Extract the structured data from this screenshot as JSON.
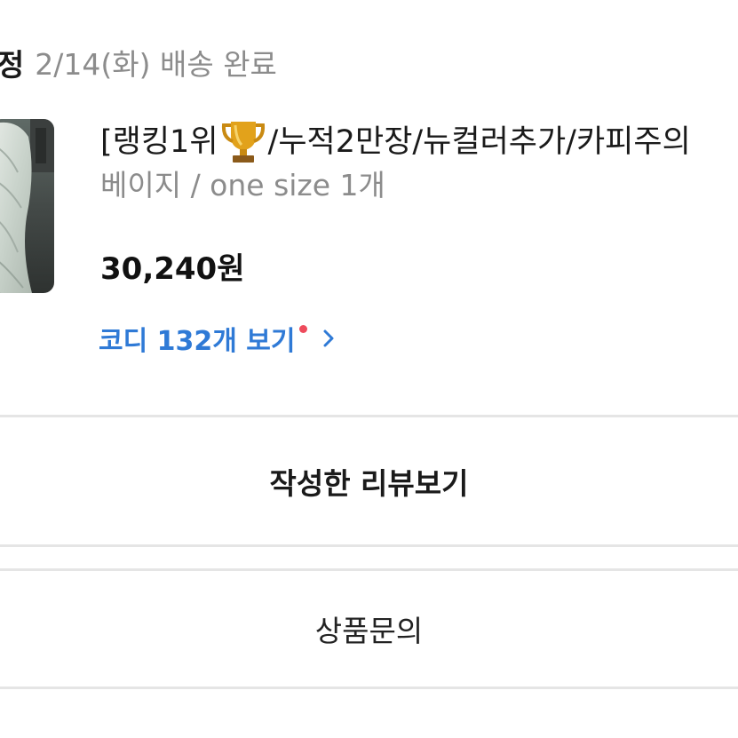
{
  "order": {
    "status_prefix": "정",
    "status_text": "2/14(화) 배송 완료"
  },
  "product": {
    "title_part1": "[랭킹1위",
    "title_icon": "trophy-icon",
    "title_part2": "/누적2만장/뉴컬러추가/카피주의",
    "option": "베이지 / one size 1개",
    "price": "30,240원"
  },
  "coordi_link": {
    "label": "코디 132개 보기",
    "icon": "chevron-right-icon",
    "dot_color": "#ee4b5c"
  },
  "actions": {
    "review_label": "작성한 리뷰보기",
    "inquiry_label": "상품문의"
  },
  "colors": {
    "link": "#2f7ad6",
    "muted_text": "#8c8c8c",
    "divider": "#e5e5e5"
  }
}
